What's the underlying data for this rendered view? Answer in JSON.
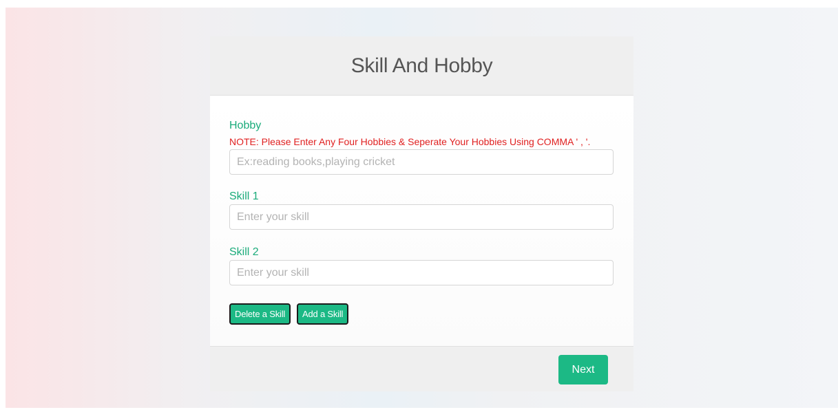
{
  "form": {
    "title": "Skill And Hobby",
    "hobby": {
      "label": "Hobby",
      "note": "NOTE: Please Enter Any Four Hobbies & Seperate Your Hobbies Using COMMA ' , '.",
      "value": "",
      "placeholder": "Ex:reading books,playing cricket"
    },
    "skills": [
      {
        "label": "Skill 1",
        "value": "",
        "placeholder": "Enter your skill"
      },
      {
        "label": "Skill 2",
        "value": "",
        "placeholder": "Enter your skill"
      }
    ],
    "delete_skill_label": "Delete a Skill",
    "add_skill_label": "Add a Skill",
    "next_label": "Next"
  },
  "colors": {
    "accent": "#1cb985",
    "label": "#1aab7a",
    "note": "#e02020",
    "title": "#555555"
  }
}
